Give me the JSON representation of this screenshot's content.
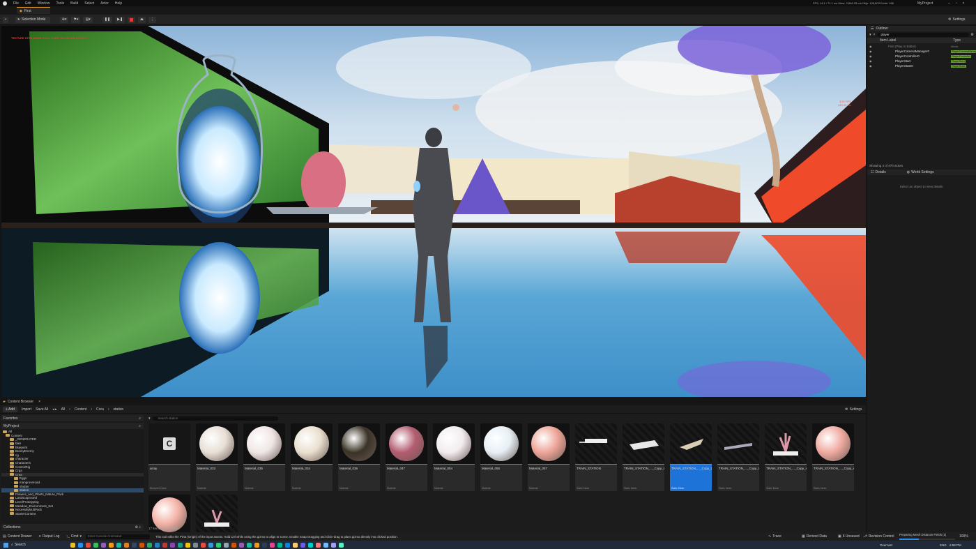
{
  "menu": [
    "File",
    "Edit",
    "Window",
    "Tools",
    "Build",
    "Select",
    "Actor",
    "Help"
  ],
  "window": {
    "project": "MyProject",
    "stats": "FPS: 14.1 / 71.1 ms  Mem: 2,846.43 mb  Objs: 126,803  Evnts: 168"
  },
  "tab": {
    "level": "First"
  },
  "toolbar": {
    "mode": "Selection Mode",
    "settings": "Settings"
  },
  "viewport": {
    "warning": "TEXTURE STREAMING POOL OVER 100.000 MB BUDGET",
    "fps_line1": "3.57 FPS",
    "fps_line2": "120.49 ms"
  },
  "outliner": {
    "title": "Outliner",
    "search": "player",
    "col_label": "Item Label",
    "col_type": "Type",
    "rows": [
      {
        "label": "First (Play In Editor)",
        "type": "World"
      },
      {
        "label": "PlayerCameraManager0",
        "type": "PlayerCameraManager"
      },
      {
        "label": "PlayerController0",
        "type": "PlayerController"
      },
      {
        "label": "PlayerStart",
        "type": "PlayerStart"
      },
      {
        "label": "PlayerState0",
        "type": "PlayerState"
      }
    ],
    "footer": "Showing 4 of 470 actors"
  },
  "details": {
    "tab1": "Details",
    "tab2": "World Settings",
    "hint": "Select an object to view details."
  },
  "content_browser": {
    "title": "Content Browser",
    "add": "+ Add",
    "import": "Import",
    "save_all": "Save All",
    "path": [
      "All",
      "Content",
      "Crea",
      "station"
    ],
    "settings": "Settings",
    "search_placeholder": "Search station",
    "favorites": "Favorites",
    "project": "MyProject",
    "tree": [
      "All",
      "Content",
      "_GENERATED",
      "bike",
      "blueprint",
      "BunnyEnemy",
      "cg",
      "character",
      "Characters",
      "ControlRig",
      "Crga",
      "Crea",
      "Eggs",
      "mangroveroad",
      "shutter",
      "station",
      "Flowers_and_Plants_Nature_Pack",
      "Landscapround",
      "LevelPrototyping",
      "Meadow_Environment_Set",
      "NecessityMultPack",
      "StarterContent"
    ],
    "collections": "Collections",
    "count": "17 items (1 selected)",
    "assets": [
      {
        "name": "array",
        "type": "Blueprint Class",
        "kind": "blueprint"
      },
      {
        "name": "Material_033",
        "type": "Material",
        "kind": "sphere",
        "color": "#e8dfd6"
      },
      {
        "name": "Material_035",
        "type": "Material",
        "kind": "sphere",
        "color": "#efe6e4"
      },
      {
        "name": "Material_034",
        "type": "Material",
        "kind": "sphere",
        "color": "#eadfcf"
      },
      {
        "name": "Material_036",
        "type": "Material",
        "kind": "sphere",
        "color": "#3a3326"
      },
      {
        "name": "Material_047",
        "type": "Material",
        "kind": "sphere",
        "color": "#b35c70"
      },
      {
        "name": "Material_054",
        "type": "Material",
        "kind": "sphere",
        "color": "#f2ecef"
      },
      {
        "name": "Material_055",
        "type": "Material",
        "kind": "sphere",
        "color": "#e6eff5"
      },
      {
        "name": "Material_057",
        "type": "Material",
        "kind": "sphere",
        "color": "#eda497"
      },
      {
        "name": "TRAIN_STATION",
        "type": "Static Mesh",
        "kind": "mesh"
      },
      {
        "name": "TRAIN_STATION_..._Copy_Cube_012",
        "type": "Static Mesh",
        "kind": "mesh"
      },
      {
        "name": "TRAIN_STATION_..._Copy_Cube_013",
        "type": "Static Mesh",
        "kind": "mesh",
        "selected": true
      },
      {
        "name": "TRAIN_STATION_..._Copy_Cube_014",
        "type": "Static Mesh",
        "kind": "mesh"
      },
      {
        "name": "TRAIN_STATION_..._Copy_icosphere_001",
        "type": "Static Mesh",
        "kind": "mesh"
      },
      {
        "name": "TRAIN_STATION_..._Copy_icosphere_002",
        "type": "Static Mesh",
        "kind": "sphere",
        "color": "#f0aaa0"
      },
      {
        "name": "",
        "type": "",
        "kind": "sphere",
        "color": "#f3b1a6"
      },
      {
        "name": "",
        "type": "",
        "kind": "mesh"
      }
    ]
  },
  "status": {
    "content_drawer": "Content Drawer",
    "output_log": "Output Log",
    "cmd": "Cmd",
    "cmd_placeholder": "Enter Console Command",
    "hint": "This tool edits the Pivot (Origin) of the input assets. Hold Ctrl while using the gizmo to align to scene. Enable Snap Dragging and click+drag to place gizmo directly into clicked position.",
    "trace": "Trace",
    "derived": "Derived Data",
    "unsaved": "6 Unsaved",
    "revision": "Revision Control",
    "task": "Preparing Mesh Distance Fields (1)",
    "zoom": "100%"
  },
  "taskbar": {
    "search": "Search",
    "lang": "ENG",
    "time": "6:58 PM",
    "tray": "Overcast"
  }
}
